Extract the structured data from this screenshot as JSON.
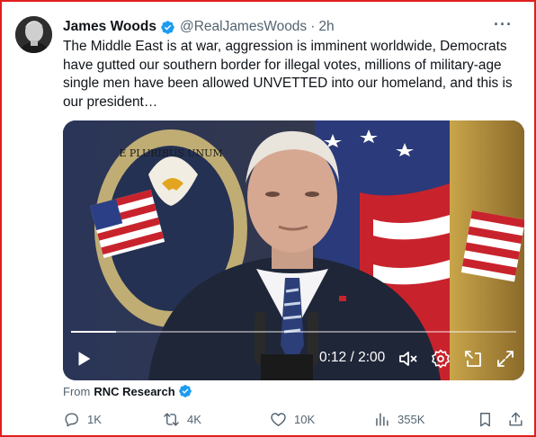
{
  "tweet": {
    "author_name": "James Woods",
    "handle": "@RealJamesWoods",
    "separator": "·",
    "time": "2h",
    "more_icon": "more-horizontal-icon",
    "text": "The Middle East is at war, aggression is imminent worldwide, Democrats have gutted our southern border for illegal votes, millions of military-age single men have been allowed UNVETTED into our homeland, and this is our president…",
    "verified": true
  },
  "video": {
    "current_time": "0:12",
    "duration": "2:00",
    "timecode": "0:12 / 2:00",
    "progress_fraction": 0.1,
    "controls": [
      "play-icon",
      "mute-icon",
      "settings-icon",
      "picture-in-picture-icon",
      "fullscreen-icon"
    ]
  },
  "source": {
    "prefix": "From",
    "name": "RNC Research",
    "verified": true
  },
  "actions": {
    "reply_count": "1K",
    "retweet_count": "4K",
    "like_count": "10K",
    "view_count": "355K"
  },
  "colors": {
    "frame_border": "#e0201e",
    "verified_blue": "#1d9bf0",
    "text_primary": "#0f1419",
    "text_secondary": "#536471"
  }
}
